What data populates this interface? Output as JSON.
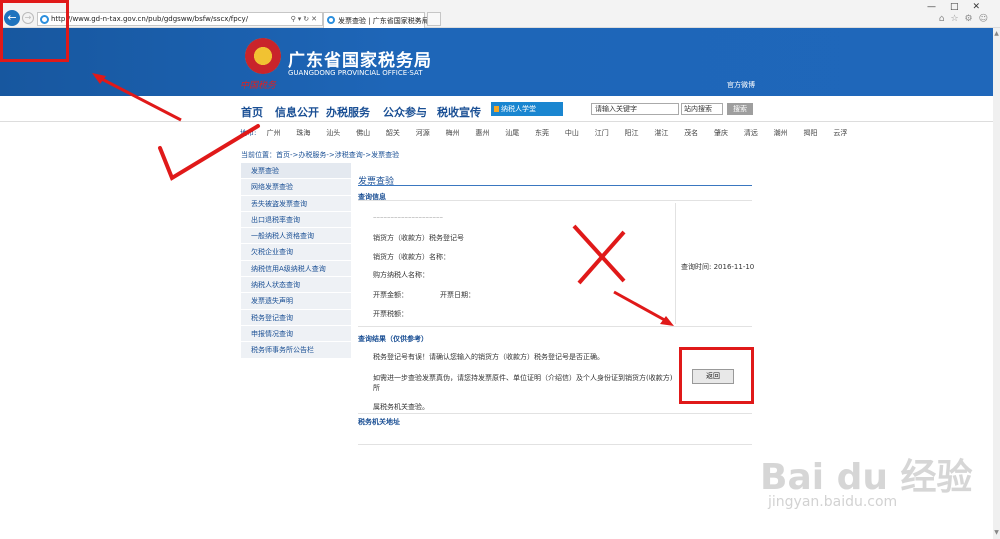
{
  "browser": {
    "url": "http://www.gd-n-tax.gov.cn/pub/gdgsww/bsfw/sscx/fpcy/",
    "tab_title": "发票查验 | 广东省国家税务局",
    "back_icon": "arrow-left-icon",
    "forward_icon": "arrow-right-icon"
  },
  "header": {
    "org_cn": "广东省国家税务局",
    "org_en": "GUANGDONG PROVINCIAL OFFICE·SAT",
    "emblem_text": "中国税务",
    "weibo": "官方微博"
  },
  "nav": {
    "items": [
      "首页",
      "信息公开",
      "办税服务",
      "公众参与",
      "税收宣传"
    ],
    "study_label": "纳税人学堂",
    "search_placeholder": "请输入关键字",
    "search_scope": "站内搜索",
    "search_button": "搜索"
  },
  "region": {
    "label": "地市:",
    "cities": [
      "广州",
      "珠海",
      "汕头",
      "佛山",
      "韶关",
      "河源",
      "梅州",
      "惠州",
      "汕尾",
      "东莞",
      "中山",
      "江门",
      "阳江",
      "湛江",
      "茂名",
      "肇庆",
      "清远",
      "潮州",
      "揭阳",
      "云浮"
    ]
  },
  "breadcrumb": "当前位置：首页->办税服务->涉税查询->发票查验",
  "sidebar": {
    "items": [
      "发票查验",
      "网络发票查验",
      "丢失被盗发票查询",
      "出口退税率查询",
      "一般纳税人资格查询",
      "欠税企业查询",
      "纳税信用A级纳税人查询",
      "纳税人状态查询",
      "发票遗失声明",
      "税务登记查询",
      "申报情况查询",
      "税务师事务所公告栏"
    ]
  },
  "main": {
    "title": "发票查验",
    "info_header": "查询信息",
    "seller_tax_id": "销货方（收款方）税务登记号",
    "seller_name": "销货方（收款方）名称：",
    "buyer_name": "购方纳税人名称：",
    "amount": "开票金额：",
    "date": "开票日期：",
    "tax": "开票税额：",
    "query_time": "查询时间: 2016-11-10",
    "result_header": "查询结果（仅供参考）",
    "result_1": "税务登记号有误！请确认您输入的销货方（收款方）税务登记号是否正确。",
    "result_2": "如需进一步查验发票真伪，请您持发票原件、单位证明（介绍信）及个人身份证到销货方(收款方)所",
    "result_3": "属税务机关查验。",
    "return_button": "返回",
    "address_header": "税务机关地址"
  },
  "watermark": {
    "big": "Bai du 经验",
    "small": "jingyan.baidu.com"
  }
}
